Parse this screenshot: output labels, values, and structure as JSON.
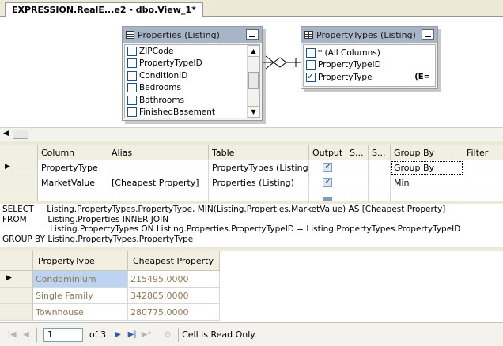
{
  "tab": {
    "title": "EXPRESSION.RealE...e2 - dbo.View_1*"
  },
  "diagram": {
    "table1": {
      "title": "Properties (Listing)",
      "columns": [
        {
          "name": "ZIPCode",
          "checked": false
        },
        {
          "name": "PropertyTypeID",
          "checked": false
        },
        {
          "name": "ConditionID",
          "checked": false
        },
        {
          "name": "Bedrooms",
          "checked": false
        },
        {
          "name": "Bathrooms",
          "checked": false
        },
        {
          "name": "FinishedBasement",
          "checked": false
        }
      ]
    },
    "table2": {
      "title": "PropertyTypes (Listing)",
      "columns": [
        {
          "name": "* (All Columns)",
          "checked": false
        },
        {
          "name": "PropertyTypeID",
          "checked": false
        },
        {
          "name": "PropertyType",
          "checked": true
        }
      ],
      "group_glyph": "(E="
    }
  },
  "criteria": {
    "headers": [
      "Column",
      "Alias",
      "Table",
      "Output",
      "S...",
      "S...",
      "Group By",
      "Filter"
    ],
    "rows": [
      {
        "column": "PropertyType",
        "alias": "",
        "table": "PropertyTypes (Listing)",
        "output": true,
        "group_by": "Group By",
        "current": true
      },
      {
        "column": "MarketValue",
        "alias": "[Cheapest Property]",
        "table": "Properties (Listing)",
        "output": true,
        "group_by": "Min",
        "current": false
      }
    ]
  },
  "sql": {
    "lines": [
      "SELECT     Listing.PropertyTypes.PropertyType, MIN(Listing.Properties.MarketValue) AS [Cheapest Property]",
      "FROM        Listing.Properties INNER JOIN",
      "                  Listing.PropertyTypes ON Listing.Properties.PropertyTypeID = Listing.PropertyTypes.PropertyTypeID",
      "GROUP BY Listing.PropertyTypes.PropertyType"
    ]
  },
  "results": {
    "headers": [
      "PropertyType",
      "Cheapest Property"
    ],
    "rows": [
      [
        "Condominium",
        "215495.0000"
      ],
      [
        "Single Family",
        "342805.0000"
      ],
      [
        "Townhouse",
        "280775.0000"
      ]
    ]
  },
  "navigator": {
    "current_record": "1",
    "of_label": "of 3",
    "status": "Cell is Read Only."
  },
  "colors": {
    "header_blue": "#a8b4c8",
    "chrome": "#ece9d8",
    "selected_cell": "#bcd4f0",
    "readonly_text": "#8a7a55"
  }
}
